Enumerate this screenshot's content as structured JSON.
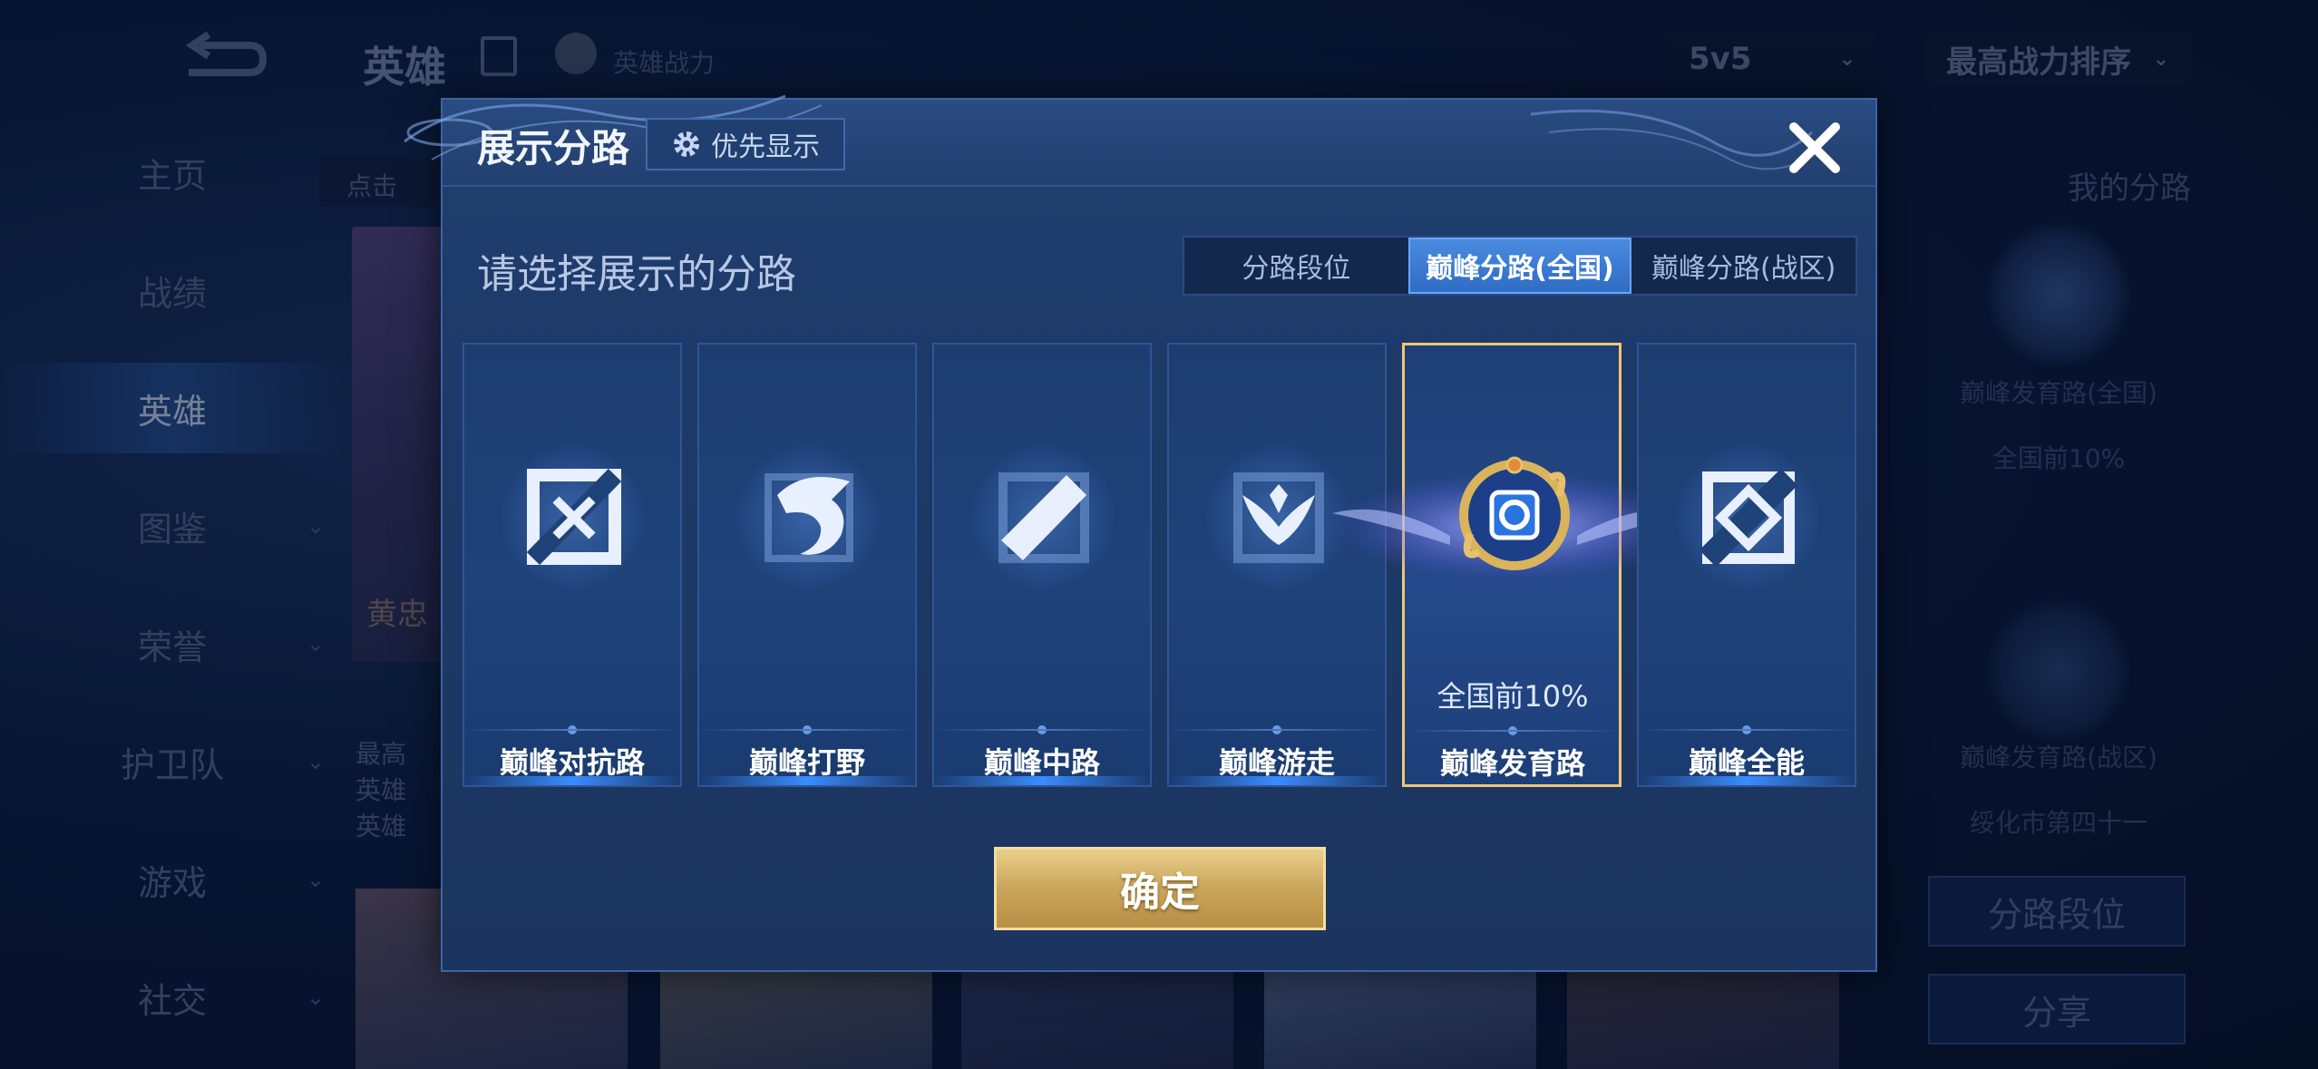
{
  "background": {
    "top_title": "英雄",
    "top_power_label": "英雄战力",
    "mode_select": "5v5",
    "sort_select": "最高战力排序",
    "search_pill": "点击",
    "sidebar": [
      {
        "label": "主页",
        "has_chevron": false
      },
      {
        "label": "战绩",
        "has_chevron": false
      },
      {
        "label": "英雄",
        "has_chevron": false
      },
      {
        "label": "图鉴",
        "has_chevron": true
      },
      {
        "label": "荣誉",
        "has_chevron": true
      },
      {
        "label": "护卫队",
        "has_chevron": true
      },
      {
        "label": "游戏",
        "has_chevron": true
      },
      {
        "label": "社交",
        "has_chevron": true
      }
    ],
    "hero_name": "黄忠",
    "hero_info": [
      "最高",
      "英雄",
      "英雄"
    ],
    "right_panel": {
      "title": "我的分路",
      "lane1_name": "巅峰发育路(全国)",
      "lane1_rank": "全国前10%",
      "lane2_name": "巅峰发育路(战区)",
      "lane2_rank": "绥化市第四十一",
      "lane_rank_button": "分路段位",
      "share_button": "分享"
    }
  },
  "modal": {
    "title": "展示分路",
    "priority_button": "优先显示",
    "subtitle": "请选择展示的分路",
    "tabs": [
      {
        "label": "分路段位",
        "active": false
      },
      {
        "label": "巅峰分路(全国)",
        "active": true
      },
      {
        "label": "巅峰分路(战区)",
        "active": false
      }
    ],
    "cards": [
      {
        "label": "巅峰对抗路",
        "icon": "clash-lane-icon",
        "selected": false,
        "rank": ""
      },
      {
        "label": "巅峰打野",
        "icon": "jungle-dragon-icon",
        "selected": false,
        "rank": ""
      },
      {
        "label": "巅峰中路",
        "icon": "mid-lane-icon",
        "selected": false,
        "rank": ""
      },
      {
        "label": "巅峰游走",
        "icon": "roam-wings-icon",
        "selected": false,
        "rank": ""
      },
      {
        "label": "巅峰发育路",
        "icon": "farm-lane-badge-icon",
        "selected": true,
        "rank": "全国前10%"
      },
      {
        "label": "巅峰全能",
        "icon": "all-round-icon",
        "selected": false,
        "rank": ""
      }
    ],
    "confirm_button": "确定"
  },
  "colors": {
    "accent_blue": "#3a8cff",
    "selected_gold": "#f0c676",
    "confirm_gold": "#caa55a"
  }
}
